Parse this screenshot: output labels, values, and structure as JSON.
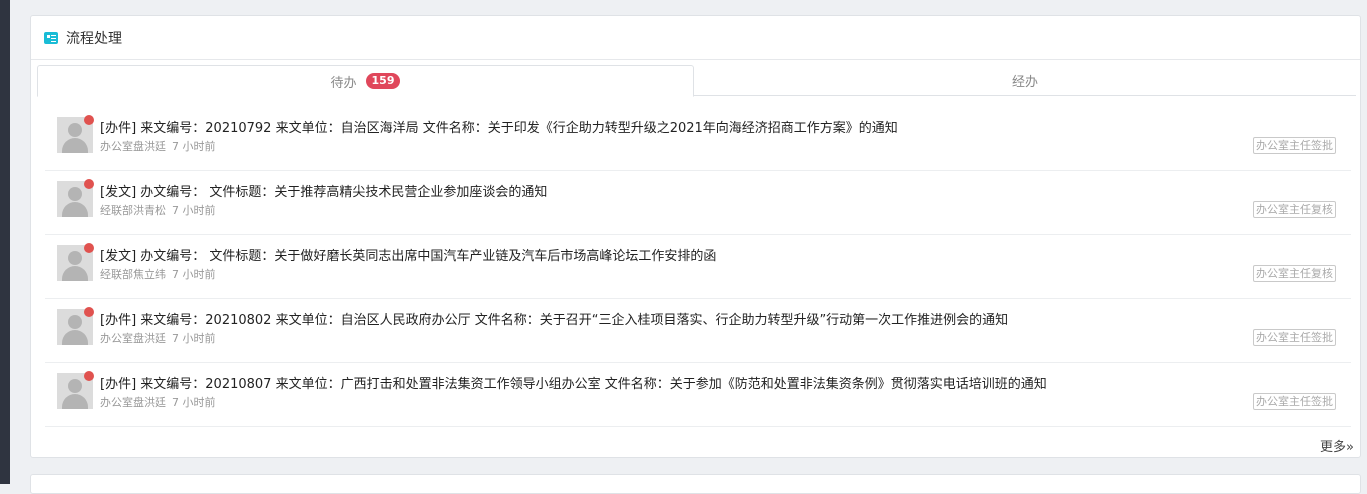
{
  "panel": {
    "title": "流程处理",
    "icon": "card-icon",
    "accent_color": "#19bcd6"
  },
  "tabs": [
    {
      "label": "待办",
      "badge": "159",
      "active": true
    },
    {
      "label": "经办",
      "active": false
    }
  ],
  "badge_color": "#e0475b",
  "items": [
    {
      "title": "[办件] 来文编号：20210792 来文单位：自治区海洋局 文件名称：关于印发《行企助力转型升级之2021年向海经济招商工作方案》的通知",
      "sender": "办公室盘洪廷",
      "time": "7 小时前",
      "status": "办公室主任签批"
    },
    {
      "title": "[发文] 办文编号： 文件标题：关于推荐高精尖技术民营企业参加座谈会的通知",
      "sender": "经联部洪青松",
      "time": "7 小时前",
      "status": "办公室主任复核"
    },
    {
      "title": "[发文] 办文编号： 文件标题：关于做好磨长英同志出席中国汽车产业链及汽车后市场高峰论坛工作安排的函",
      "sender": "经联部焦立纬",
      "time": "7 小时前",
      "status": "办公室主任复核"
    },
    {
      "title": "[办件] 来文编号：20210802 来文单位：自治区人民政府办公厅 文件名称：关于召开“三企入桂项目落实、行企助力转型升级”行动第一次工作推进例会的通知",
      "sender": "办公室盘洪廷",
      "time": "7 小时前",
      "status": "办公室主任签批"
    },
    {
      "title": "[办件] 来文编号：20210807 来文单位：广西打击和处置非法集资工作领导小组办公室 文件名称：关于参加《防范和处置非法集资条例》贯彻落实电话培训班的通知",
      "sender": "办公室盘洪廷",
      "time": "7 小时前",
      "status": "办公室主任签批"
    }
  ],
  "more_label": "更多»"
}
